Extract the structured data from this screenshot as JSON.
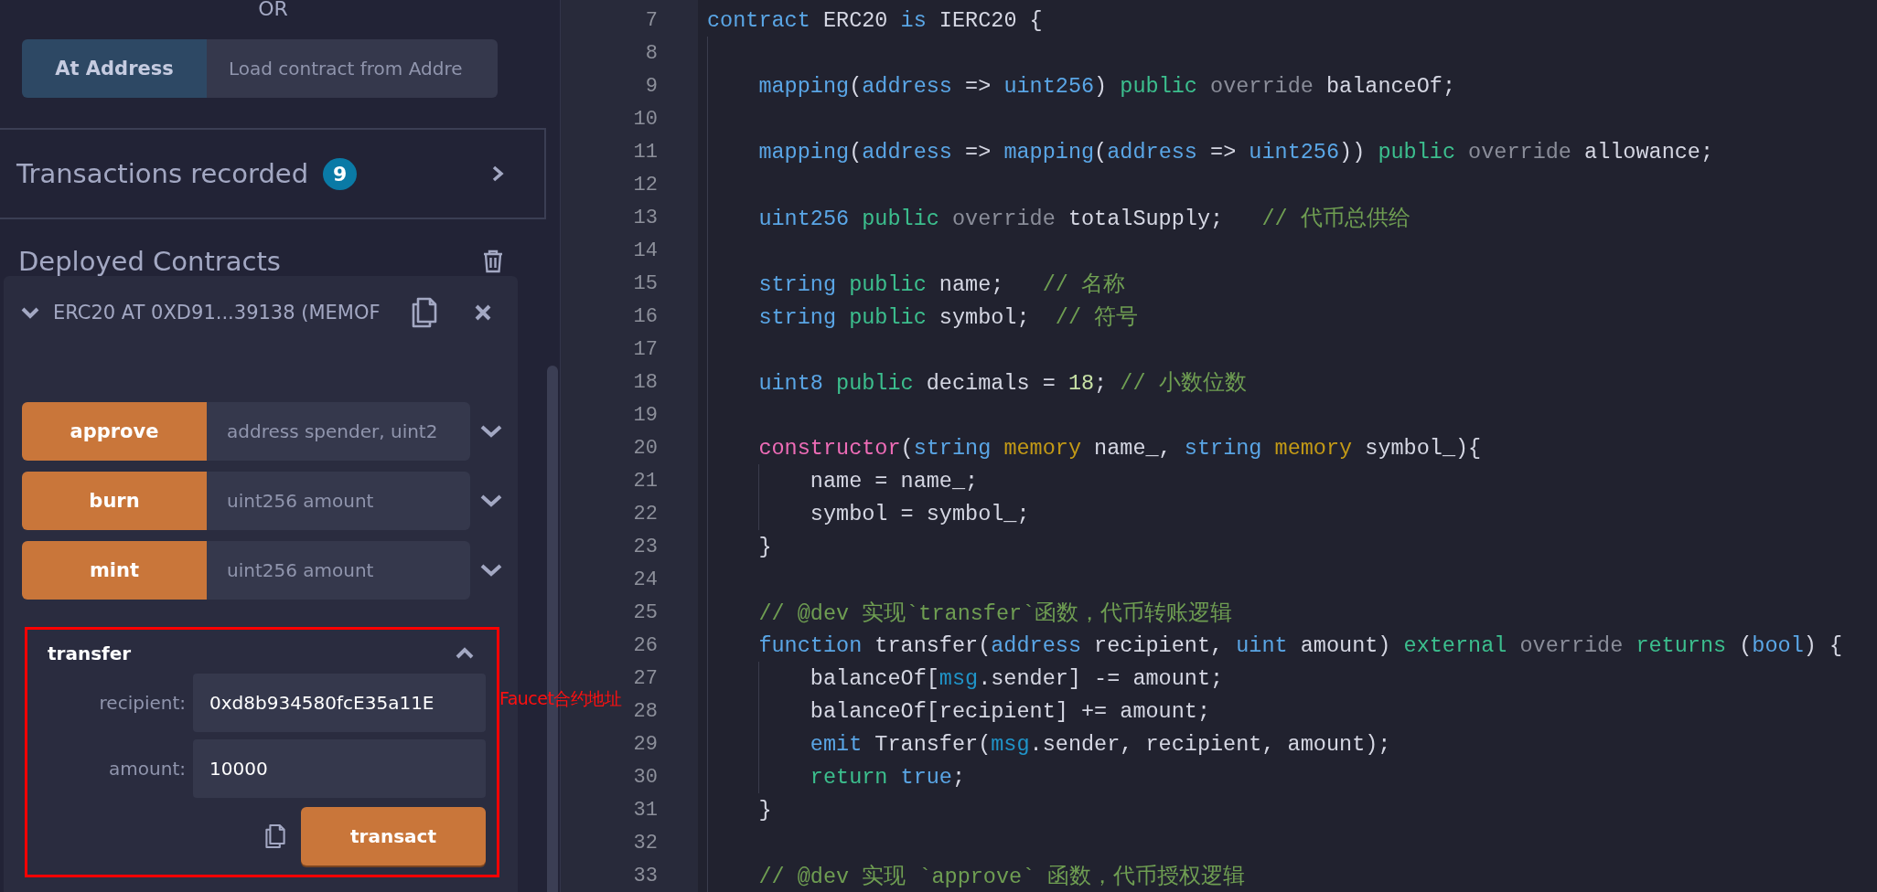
{
  "left_panel": {
    "or_label": "OR",
    "at_address": {
      "button": "At Address",
      "placeholder": "Load contract from Addre"
    },
    "transactions": {
      "label": "Transactions recorded",
      "count": "9"
    },
    "deployed": {
      "title": "Deployed Contracts"
    },
    "contract": {
      "title": "ERC20 AT 0XD91...39138 (MEMOF",
      "expanded": true,
      "functions": [
        {
          "name": "approve",
          "placeholder": "address spender, uint2",
          "expanded": false
        },
        {
          "name": "burn",
          "placeholder": "uint256 amount",
          "expanded": false
        },
        {
          "name": "mint",
          "placeholder": "uint256 amount",
          "expanded": false
        },
        {
          "name": "transfer",
          "expanded": true,
          "params": [
            {
              "label": "recipient:",
              "value": "0xd8b934580fcE35a11E"
            },
            {
              "label": "amount:",
              "value": "10000"
            }
          ],
          "action": "transact"
        }
      ]
    }
  },
  "annotation": {
    "text": "Faucet合约地址"
  },
  "editor": {
    "lines": [
      {
        "number": "7",
        "tokens": [
          {
            "text": "contract",
            "kind": "keyword"
          },
          {
            "text": " ERC20 ",
            "kind": "plain"
          },
          {
            "text": "is",
            "kind": "keyword"
          },
          {
            "text": " IERC20 {",
            "kind": "plain"
          }
        ]
      },
      {
        "number": "8"
      },
      {
        "number": "9",
        "tokens": [
          {
            "text": "    mapping",
            "kind": "keyword"
          },
          {
            "text": "(",
            "kind": "plain"
          },
          {
            "text": "address",
            "kind": "keyword"
          },
          {
            "text": " => ",
            "kind": "plain"
          },
          {
            "text": "uint256",
            "kind": "keyword"
          },
          {
            "text": ") ",
            "kind": "plain"
          },
          {
            "text": "public",
            "kind": "visibility"
          },
          {
            "text": " override",
            "kind": "modifier"
          },
          {
            "text": " balanceOf;",
            "kind": "plain"
          }
        ]
      },
      {
        "number": "10"
      },
      {
        "number": "11",
        "tokens": [
          {
            "text": "    mapping",
            "kind": "keyword"
          },
          {
            "text": "(",
            "kind": "plain"
          },
          {
            "text": "address",
            "kind": "keyword"
          },
          {
            "text": " => ",
            "kind": "plain"
          },
          {
            "text": "mapping",
            "kind": "keyword"
          },
          {
            "text": "(",
            "kind": "plain"
          },
          {
            "text": "address",
            "kind": "keyword"
          },
          {
            "text": " => ",
            "kind": "plain"
          },
          {
            "text": "uint256",
            "kind": "keyword"
          },
          {
            "text": ")) ",
            "kind": "plain"
          },
          {
            "text": "public",
            "kind": "visibility"
          },
          {
            "text": " override",
            "kind": "modifier"
          },
          {
            "text": " allowance;",
            "kind": "plain"
          }
        ]
      },
      {
        "number": "12"
      },
      {
        "number": "13",
        "tokens": [
          {
            "text": "    uint256",
            "kind": "keyword"
          },
          {
            "text": " public",
            "kind": "visibility"
          },
          {
            "text": " override",
            "kind": "modifier"
          },
          {
            "text": " totalSupply;   ",
            "kind": "plain"
          },
          {
            "text": "// 代币总供给",
            "kind": "comment"
          }
        ]
      },
      {
        "number": "14"
      },
      {
        "number": "15",
        "tokens": [
          {
            "text": "    string",
            "kind": "keyword"
          },
          {
            "text": " public",
            "kind": "visibility"
          },
          {
            "text": " name;   ",
            "kind": "plain"
          },
          {
            "text": "// 名称",
            "kind": "comment"
          }
        ]
      },
      {
        "number": "16",
        "tokens": [
          {
            "text": "    string",
            "kind": "keyword"
          },
          {
            "text": " public",
            "kind": "visibility"
          },
          {
            "text": " symbol;  ",
            "kind": "plain"
          },
          {
            "text": "// 符号",
            "kind": "comment"
          }
        ]
      },
      {
        "number": "17"
      },
      {
        "number": "18",
        "tokens": [
          {
            "text": "    uint8",
            "kind": "keyword"
          },
          {
            "text": " public",
            "kind": "visibility"
          },
          {
            "text": " decimals = ",
            "kind": "plain"
          },
          {
            "text": "18",
            "kind": "number"
          },
          {
            "text": "; ",
            "kind": "plain"
          },
          {
            "text": "// 小数位数",
            "kind": "comment"
          }
        ]
      },
      {
        "number": "19"
      },
      {
        "number": "20",
        "tokens": [
          {
            "text": "    constructor",
            "kind": "constructor"
          },
          {
            "text": "(",
            "kind": "plain"
          },
          {
            "text": "string",
            "kind": "keyword"
          },
          {
            "text": " memory",
            "kind": "storage"
          },
          {
            "text": " name_, ",
            "kind": "plain"
          },
          {
            "text": "string",
            "kind": "keyword"
          },
          {
            "text": " memory",
            "kind": "storage"
          },
          {
            "text": " symbol_){",
            "kind": "plain"
          }
        ]
      },
      {
        "number": "21",
        "tokens": [
          {
            "text": "        name = name_;",
            "kind": "plain"
          }
        ]
      },
      {
        "number": "22",
        "tokens": [
          {
            "text": "        symbol = symbol_;",
            "kind": "plain"
          }
        ]
      },
      {
        "number": "23",
        "tokens": [
          {
            "text": "    }",
            "kind": "plain"
          }
        ]
      },
      {
        "number": "24"
      },
      {
        "number": "25",
        "tokens": [
          {
            "text": "    // @dev 实现`transfer`函数，代币转账逻辑",
            "kind": "comment"
          }
        ]
      },
      {
        "number": "26",
        "tokens": [
          {
            "text": "    function",
            "kind": "keyword"
          },
          {
            "text": " transfer(",
            "kind": "plain"
          },
          {
            "text": "address",
            "kind": "keyword"
          },
          {
            "text": " recipient, ",
            "kind": "plain"
          },
          {
            "text": "uint",
            "kind": "keyword"
          },
          {
            "text": " amount) ",
            "kind": "plain"
          },
          {
            "text": "external",
            "kind": "visibility"
          },
          {
            "text": " override",
            "kind": "modifier"
          },
          {
            "text": " returns",
            "kind": "visibility"
          },
          {
            "text": " (",
            "kind": "plain"
          },
          {
            "text": "bool",
            "kind": "keyword"
          },
          {
            "text": ") {",
            "kind": "plain"
          }
        ]
      },
      {
        "number": "27",
        "tokens": [
          {
            "text": "        balanceOf[",
            "kind": "plain"
          },
          {
            "text": "msg",
            "kind": "global"
          },
          {
            "text": ".sender] -= amount;",
            "kind": "plain"
          }
        ]
      },
      {
        "number": "28",
        "tokens": [
          {
            "text": "        balanceOf[recipient] += amount;",
            "kind": "plain"
          }
        ]
      },
      {
        "number": "29",
        "tokens": [
          {
            "text": "        emit",
            "kind": "keyword"
          },
          {
            "text": " Transfer(",
            "kind": "plain"
          },
          {
            "text": "msg",
            "kind": "global"
          },
          {
            "text": ".sender, recipient, amount);",
            "kind": "plain"
          }
        ]
      },
      {
        "number": "30",
        "tokens": [
          {
            "text": "        return",
            "kind": "visibility"
          },
          {
            "text": " true",
            "kind": "keyword"
          },
          {
            "text": ";",
            "kind": "plain"
          }
        ]
      },
      {
        "number": "31",
        "tokens": [
          {
            "text": "    }",
            "kind": "plain"
          }
        ]
      },
      {
        "number": "32"
      },
      {
        "number": "33",
        "tokens": [
          {
            "text": "    // @dev 实现 `approve` 函数，代币授权逻辑",
            "kind": "comment"
          }
        ]
      }
    ]
  }
}
